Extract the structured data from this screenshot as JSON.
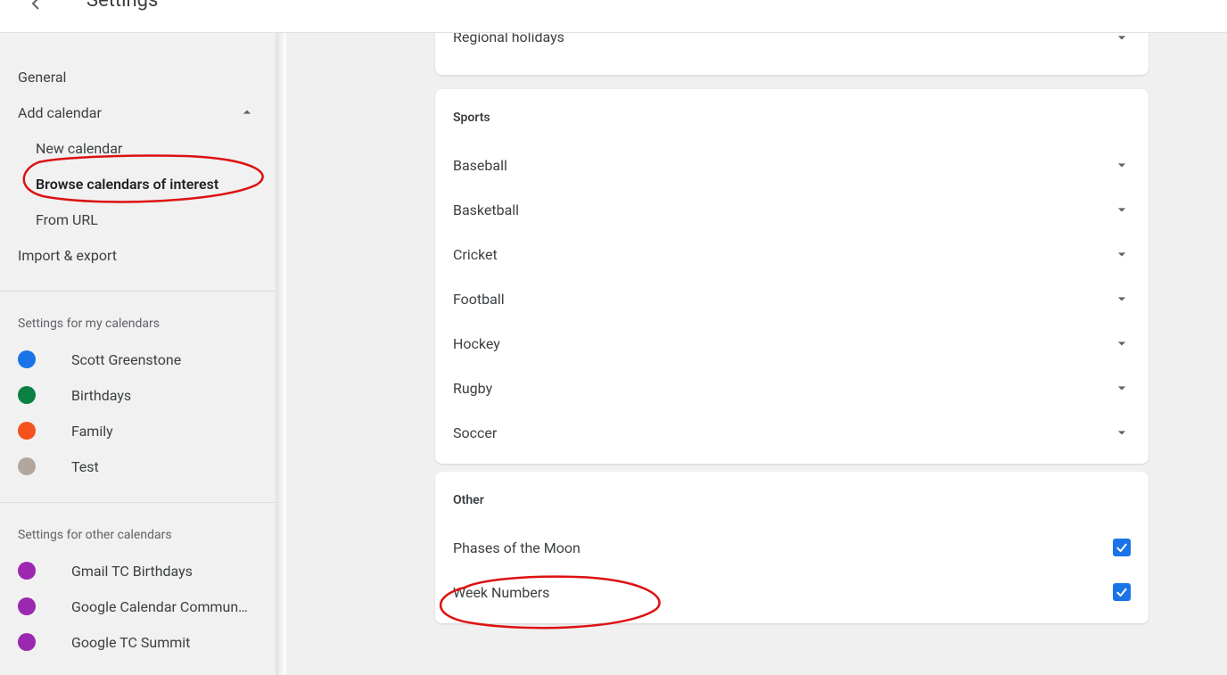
{
  "header": {
    "title": "Settings"
  },
  "sidebar": {
    "general": "General",
    "add_calendar": {
      "label": "Add calendar",
      "expanded": true,
      "items": [
        "New calendar",
        "Browse calendars of interest",
        "From URL"
      ],
      "selected_index": 1
    },
    "import_export": "Import & export",
    "my_calendars": {
      "label": "Settings for my calendars",
      "calendars": [
        {
          "name": "Scott Greenstone",
          "color": "#1a73e8"
        },
        {
          "name": "Birthdays",
          "color": "#0b8043"
        },
        {
          "name": "Family",
          "color": "#f5511e"
        },
        {
          "name": "Test",
          "color": "#b3a79d"
        }
      ]
    },
    "other_calendars": {
      "label": "Settings for other calendars",
      "calendars": [
        {
          "name": "Gmail TC Birthdays",
          "color": "#9c27b0"
        },
        {
          "name": "Google Calendar Commun…",
          "color": "#9c27b0"
        },
        {
          "name": "Google TC Summit",
          "color": "#9c27b0"
        }
      ]
    }
  },
  "content": {
    "regional_card_item": "Regional holidays",
    "sports": {
      "title": "Sports",
      "items": [
        "Baseball",
        "Basketball",
        "Cricket",
        "Football",
        "Hockey",
        "Rugby",
        "Soccer"
      ]
    },
    "other": {
      "title": "Other",
      "items": [
        {
          "label": "Phases of the Moon",
          "checked": true
        },
        {
          "label": "Week Numbers",
          "checked": true
        }
      ]
    }
  }
}
